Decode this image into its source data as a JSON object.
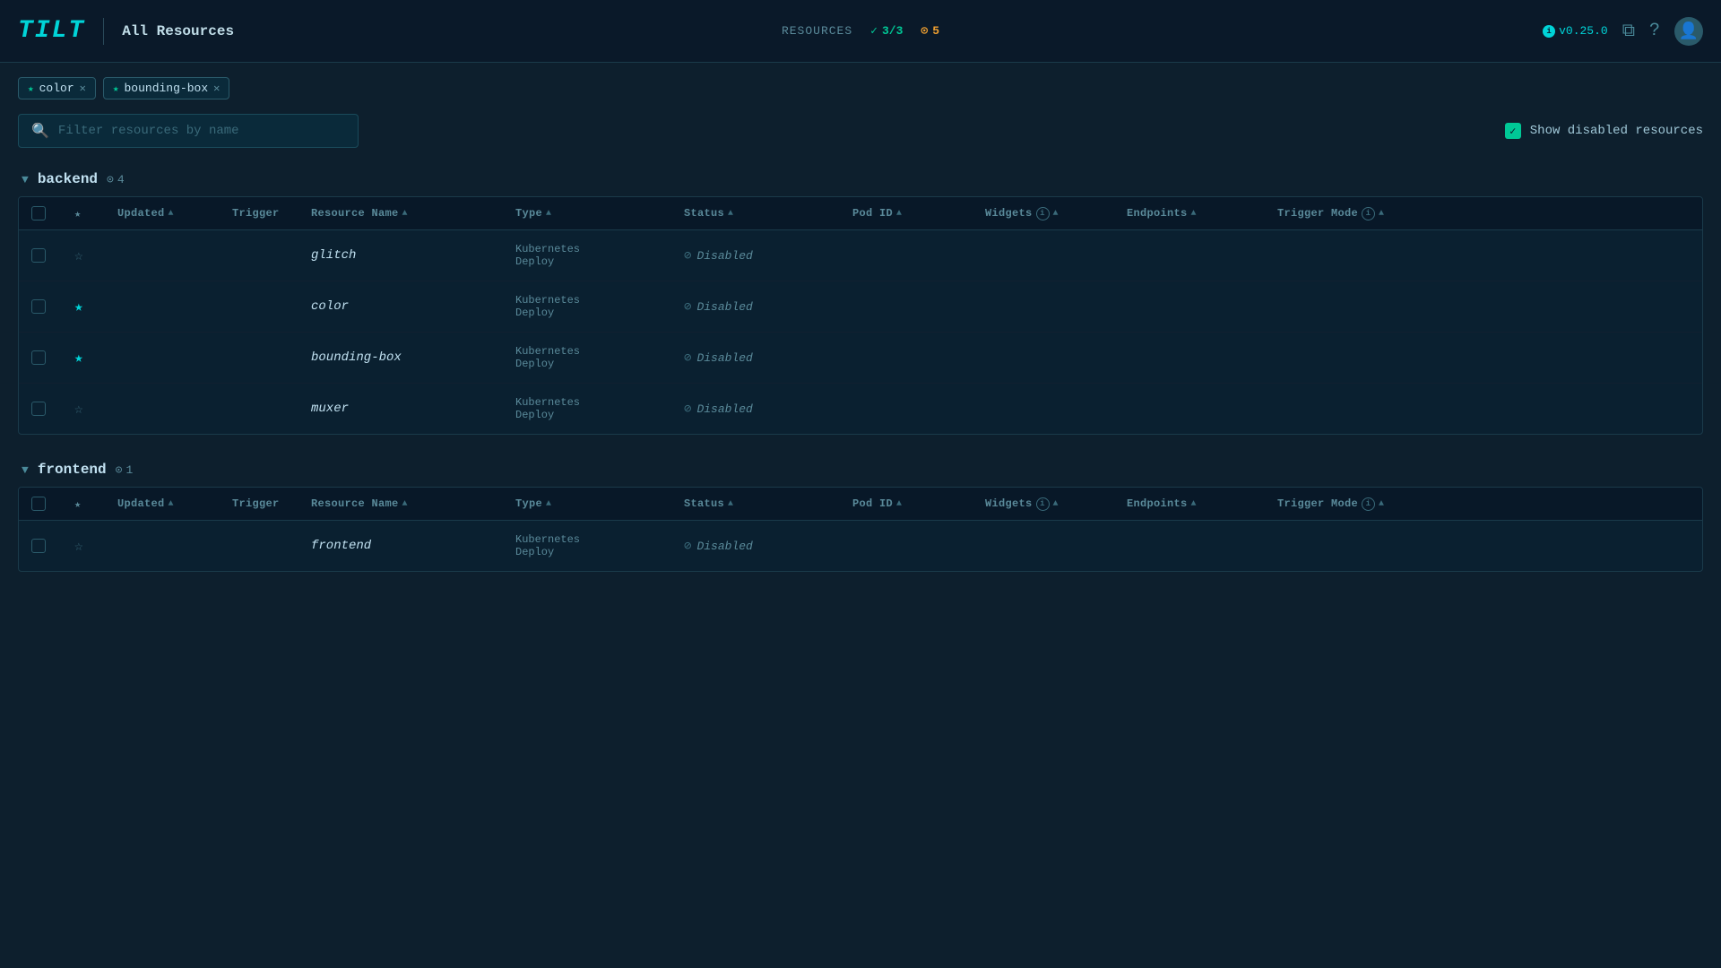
{
  "header": {
    "logo": "TILT",
    "page_title": "All Resources",
    "resources_label": "RESOURCES",
    "resources_ok": "3/3",
    "resources_warning": "5",
    "version": "v0.25.0"
  },
  "filter_tags": [
    {
      "label": "color",
      "starred": true
    },
    {
      "label": "bounding-box",
      "starred": true
    }
  ],
  "search": {
    "placeholder": "Filter resources by name"
  },
  "show_disabled": {
    "label": "Show disabled resources",
    "checked": true
  },
  "groups": [
    {
      "name": "backend",
      "count": 4,
      "columns": [
        "Updated",
        "Trigger",
        "Resource Name",
        "Type",
        "Status",
        "Pod ID",
        "Widgets",
        "Endpoints",
        "Trigger Mode"
      ],
      "rows": [
        {
          "name": "glitch",
          "type": "Kubernetes\nDeploy",
          "status": "Disabled",
          "starred": false
        },
        {
          "name": "color",
          "type": "Kubernetes\nDeploy",
          "status": "Disabled",
          "starred": true
        },
        {
          "name": "bounding-box",
          "type": "Kubernetes\nDeploy",
          "status": "Disabled",
          "starred": true
        },
        {
          "name": "muxer",
          "type": "Kubernetes\nDeploy",
          "status": "Disabled",
          "starred": false
        }
      ]
    },
    {
      "name": "frontend",
      "count": 1,
      "columns": [
        "Updated",
        "Trigger",
        "Resource Name",
        "Type",
        "Status",
        "Pod ID",
        "Widgets",
        "Endpoints",
        "Trigger Mode"
      ],
      "rows": [
        {
          "name": "frontend",
          "type": "Kubernetes\nDeploy",
          "status": "Disabled",
          "starred": false
        }
      ]
    }
  ]
}
